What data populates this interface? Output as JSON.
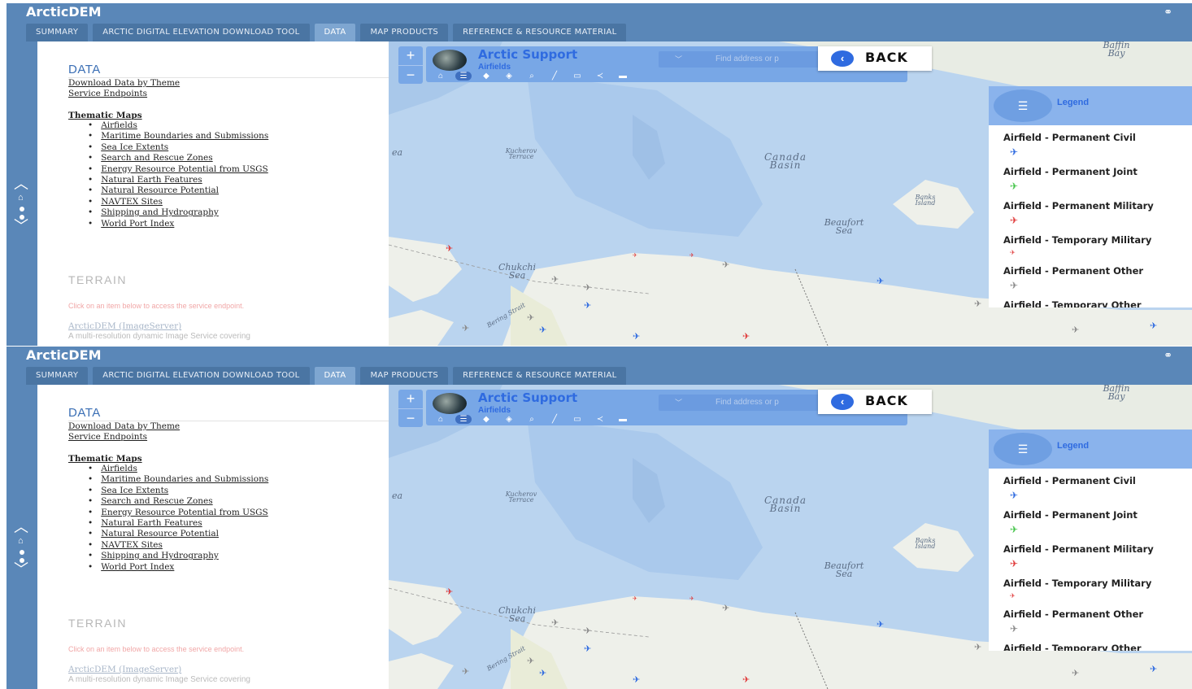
{
  "app": {
    "title": "ArcticDEM"
  },
  "tabs": [
    {
      "label": "SUMMARY"
    },
    {
      "label": "ARCTIC DIGITAL ELEVATION DOWNLOAD TOOL"
    },
    {
      "label": "DATA"
    },
    {
      "label": "MAP PRODUCTS"
    },
    {
      "label": "REFERENCE & RESOURCE MATERIAL"
    }
  ],
  "active_tab": "DATA",
  "content": {
    "heading": "DATA",
    "links": [
      "Download Data by Theme",
      "Service Endpoints"
    ],
    "thematic_title": "Thematic Maps",
    "thematic_items": [
      "Airfields",
      "Maritime Boundaries and Submissions",
      "Sea Ice Extents",
      "Search and Rescue Zones",
      "Energy Resource Potential from USGS",
      "Natural Earth Features",
      "Natural Resource Potential",
      "NAVTEX Sites",
      "Shipping and Hydrography",
      "World Port Index"
    ],
    "terrain_heading": "TERRAIN",
    "terrain_hint": "Click on an item below to access the service endpoint.",
    "service_link": "ArcticDEM (ImageServer)",
    "service_desc": "A multi-resolution dynamic Image Service covering"
  },
  "map": {
    "brand_title": "Arctic Support",
    "brand_subtitle": "Airfields",
    "search_placeholder": "Find address or p",
    "back_label": "BACK",
    "zoom_in": "+",
    "zoom_out": "−",
    "labels": {
      "baffin": "Baffin Bay",
      "kucherov": "Kucherov Terrace",
      "canada_basin": "Canada Basin",
      "banks": "Banks Island",
      "beaufort": "Beaufort Sea",
      "chukchi": "Chukchi Sea",
      "bering": "Bering Strait",
      "partial_left": "ea"
    },
    "legend": {
      "title": "Legend",
      "items": [
        {
          "label": "Airfield - Permanent Civil",
          "color": "#2f6be0"
        },
        {
          "label": "Airfield - Permanent Joint",
          "color": "#44c449"
        },
        {
          "label": "Airfield - Permanent Military",
          "color": "#e03a3a"
        },
        {
          "label": "Airfield - Temporary Military",
          "color": "#e03a3a"
        },
        {
          "label": "Airfield - Permanent Other",
          "color": "#8a8a8a"
        },
        {
          "label": "Airfield - Temporary Other",
          "color": "#8a8a8a"
        }
      ]
    }
  },
  "icons": {
    "plane": "✈",
    "home": "⌂",
    "list": "☰",
    "chevron_up": "︿",
    "chevron_down": "﹀",
    "back": "‹",
    "link": "🔗"
  }
}
